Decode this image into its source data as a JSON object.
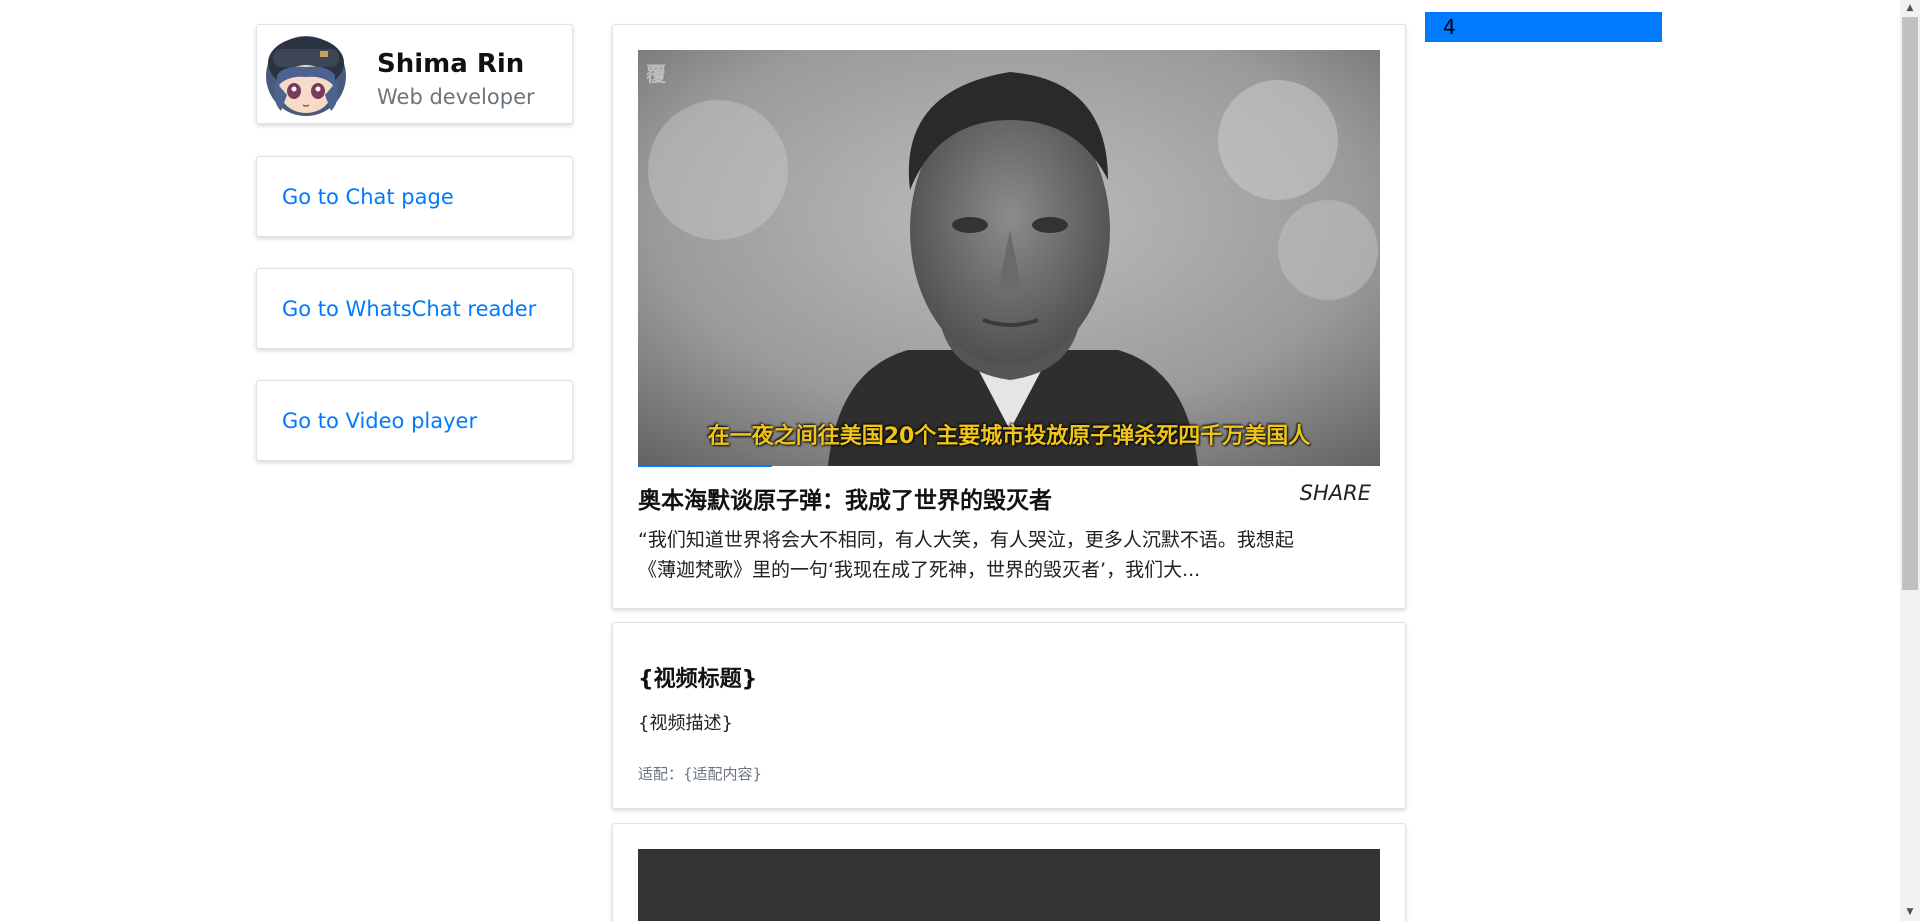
{
  "profile": {
    "name": "Shima Rin",
    "role": "Web developer",
    "avatar_icon": "anime-avatar-icon"
  },
  "nav": {
    "items": [
      {
        "label": "Go to Chat page"
      },
      {
        "label": "Go to WhatsChat reader"
      },
      {
        "label": "Go to Video player"
      }
    ]
  },
  "video": {
    "subtitle": "在一夜之间往美国20个主要城市投放原子弹杀死四千万美国人",
    "title": "奥本海默谈原子弹：我成了世界的毁灭者",
    "share_label": "SHARE",
    "description": "“我们知道世界将会大不相同，有人大笑，有人哭泣，更多人沉默不语。我想起《薄迦梵歌》里的一句‘我现在成了死神，世界的毁灭者’，我们大...",
    "progress_percent": 18
  },
  "template": {
    "title": "{视频标题}",
    "description": "{视频描述}",
    "adapt": "适配：{适配内容}"
  },
  "counter": {
    "value": "4"
  },
  "colors": {
    "accent": "#007bff",
    "subtitle": "#f0c419"
  }
}
